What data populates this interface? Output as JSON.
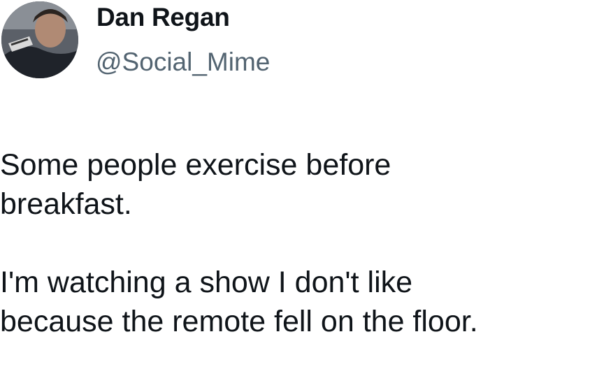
{
  "author": {
    "display_name": "Dan Regan",
    "handle": "@Social_Mime",
    "avatar_icon": "profile-photo"
  },
  "tweet": {
    "paragraphs": [
      {
        "lines": [
          "Some people exercise before",
          "breakfast."
        ]
      },
      {
        "lines": [
          "I'm watching a show I don't like",
          "because the remote fell on the floor."
        ]
      }
    ]
  },
  "colors": {
    "background": "#ffffff",
    "text": "#0f1419",
    "handle": "#536471"
  }
}
